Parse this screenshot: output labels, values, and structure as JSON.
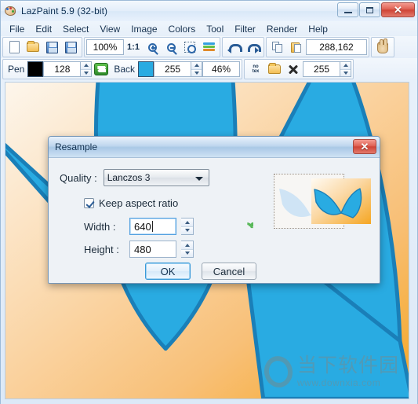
{
  "window": {
    "title": "LazPaint 5.9 (32-bit)",
    "app_icon": "palette-icon",
    "minimize_label": "",
    "maximize_label": "",
    "close_label": "✕"
  },
  "menubar": {
    "items": [
      {
        "label": "File"
      },
      {
        "label": "Edit"
      },
      {
        "label": "Select"
      },
      {
        "label": "View"
      },
      {
        "label": "Image"
      },
      {
        "label": "Colors"
      },
      {
        "label": "Tool"
      },
      {
        "label": "Filter"
      },
      {
        "label": "Render"
      },
      {
        "label": "Help"
      }
    ]
  },
  "toolbar_row1": {
    "new_icon": "new-document-icon",
    "open_icon": "open-folder-icon",
    "save_icon": "save-disk-icon",
    "saveas_icon": "save-as-disk-icon",
    "zoom_value": "100%",
    "zoom_one_to_one": "1:1",
    "zoom_in_icon": "zoom-in-icon",
    "zoom_out_icon": "zoom-out-icon",
    "zoom_fit_icon": "zoom-selection-icon",
    "layers_icon": "layers-icon",
    "undo_icon": "undo-icon",
    "redo_icon": "redo-icon",
    "copy_icon": "copy-icon",
    "paste_icon": "paste-icon",
    "dimensions": "288,162",
    "hand_icon": "hand-pan-icon"
  },
  "toolbar_row2": {
    "pen_label": "Pen",
    "pen_color": "#000000",
    "pen_alpha": "128",
    "swap_icon": "swap-colors-icon",
    "back_label": "Back",
    "back_color": "#29ABE2",
    "back_alpha": "255",
    "tolerance": "46%",
    "notex_label_line1": "no",
    "notex_label_line2": "tex",
    "texture_open_icon": "open-texture-folder-icon",
    "texture_remove_icon": "remove-texture-icon",
    "texture_alpha": "255"
  },
  "dialog": {
    "title": "Resample",
    "close_label": "✕",
    "quality_label": "Quality :",
    "quality_value": "Lanczos 3",
    "quality_options": [
      "Lanczos 3"
    ],
    "keep_aspect_label": "Keep aspect ratio",
    "keep_aspect_checked": true,
    "width_label": "Width :",
    "width_value": "640",
    "height_label": "Height :",
    "height_value": "480",
    "refresh_icon": "refresh-preview-icon",
    "preview_icon": "resample-preview",
    "ok_label": "OK",
    "cancel_label": "Cancel"
  },
  "canvas": {
    "description": "orange gradient background with blue polygon shapes",
    "bg_from": "#fdf2e4",
    "bg_to": "#f5a623",
    "shape_fill": "#29ABE2",
    "shape_stroke": "#1a7fb8"
  },
  "watermark": {
    "cn_text": "当下软件园",
    "url_text": "www.downxia.com"
  }
}
